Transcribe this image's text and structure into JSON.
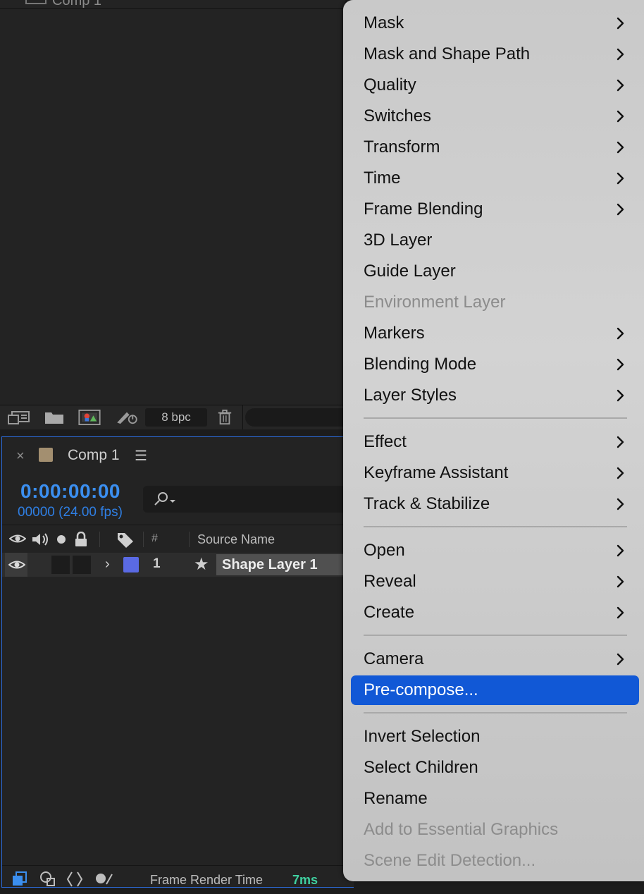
{
  "project_panel": {
    "cut_title": "Comp 1",
    "bit_depth": "8 bpc"
  },
  "timeline": {
    "tab_title": "Comp 1",
    "current_time": "0:00:00:00",
    "frame_info": "00000 (24.00 fps)",
    "columns": {
      "number": "#",
      "source_name": "Source Name"
    },
    "layer": {
      "number": "1",
      "name": "Shape Layer 1",
      "label_color": "#5a6ae4"
    },
    "footer": {
      "render_label": "Frame Render Time",
      "render_value": "7ms"
    }
  },
  "menu": {
    "items": [
      {
        "label": "Mask",
        "submenu": true,
        "disabled": false
      },
      {
        "label": "Mask and Shape Path",
        "submenu": true,
        "disabled": false
      },
      {
        "label": "Quality",
        "submenu": true,
        "disabled": false
      },
      {
        "label": "Switches",
        "submenu": true,
        "disabled": false
      },
      {
        "label": "Transform",
        "submenu": true,
        "disabled": false
      },
      {
        "label": "Time",
        "submenu": true,
        "disabled": false
      },
      {
        "label": "Frame Blending",
        "submenu": true,
        "disabled": false
      },
      {
        "label": "3D Layer",
        "submenu": false,
        "disabled": false
      },
      {
        "label": "Guide Layer",
        "submenu": false,
        "disabled": false
      },
      {
        "label": "Environment Layer",
        "submenu": false,
        "disabled": true
      },
      {
        "label": "Markers",
        "submenu": true,
        "disabled": false
      },
      {
        "label": "Blending Mode",
        "submenu": true,
        "disabled": false
      },
      {
        "label": "Layer Styles",
        "submenu": true,
        "disabled": false
      },
      {
        "label": "Effect",
        "submenu": true,
        "disabled": false
      },
      {
        "label": "Keyframe Assistant",
        "submenu": true,
        "disabled": false
      },
      {
        "label": "Track & Stabilize",
        "submenu": true,
        "disabled": false
      },
      {
        "label": "Open",
        "submenu": true,
        "disabled": false
      },
      {
        "label": "Reveal",
        "submenu": true,
        "disabled": false
      },
      {
        "label": "Create",
        "submenu": true,
        "disabled": false
      },
      {
        "label": "Camera",
        "submenu": true,
        "disabled": false
      },
      {
        "label": "Pre-compose...",
        "submenu": false,
        "disabled": false,
        "highlighted": true
      },
      {
        "label": "Invert Selection",
        "submenu": false,
        "disabled": false
      },
      {
        "label": "Select Children",
        "submenu": false,
        "disabled": false
      },
      {
        "label": "Rename",
        "submenu": false,
        "disabled": false
      },
      {
        "label": "Add to Essential Graphics",
        "submenu": false,
        "disabled": true
      },
      {
        "label": "Scene Edit Detection...",
        "submenu": false,
        "disabled": true
      }
    ],
    "highlight_color": "#1158d6"
  }
}
